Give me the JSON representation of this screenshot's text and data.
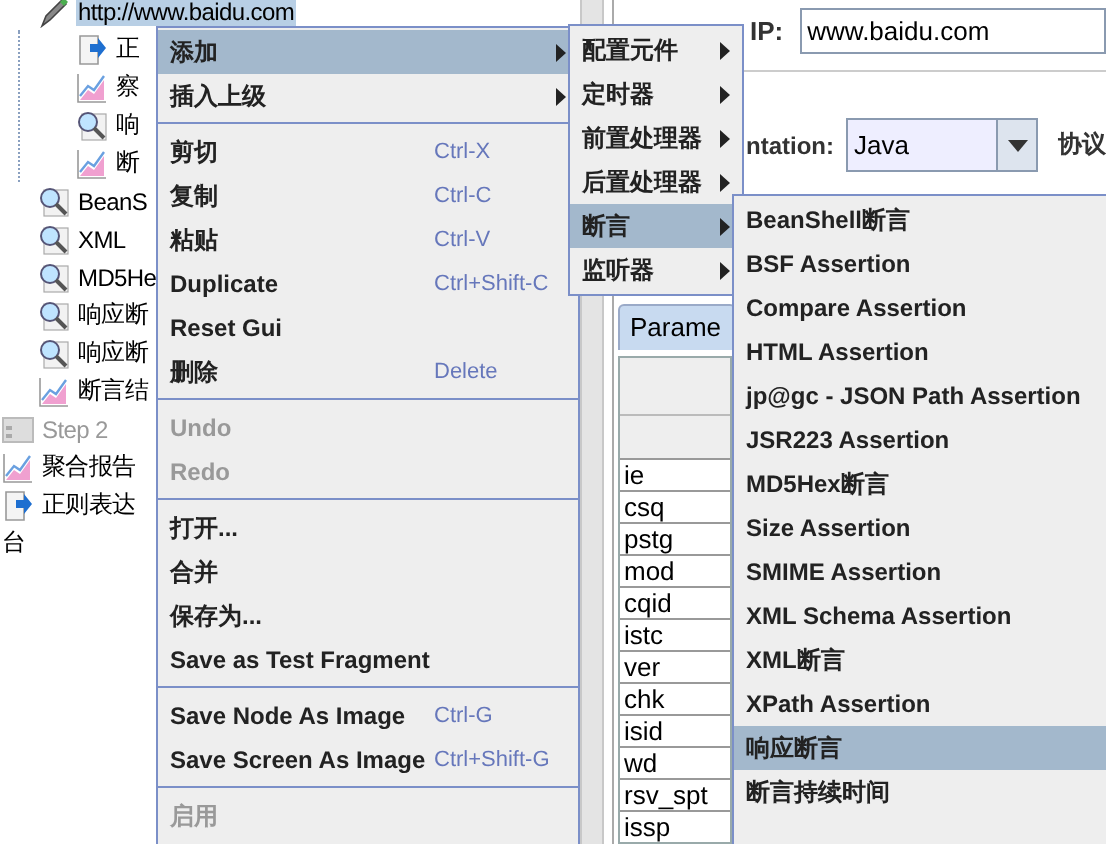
{
  "tree": {
    "items": [
      {
        "label": "http://www.baidu.com",
        "kind": "sampler",
        "selected": true,
        "disabled": false,
        "children": [
          {
            "label": "正",
            "kind": "extractor",
            "selected": false,
            "disabled": false
          },
          {
            "label": "察",
            "kind": "chart",
            "selected": false,
            "disabled": false
          },
          {
            "label": "响",
            "kind": "magnifier",
            "selected": false,
            "disabled": false
          },
          {
            "label": "断",
            "kind": "chart",
            "selected": false,
            "disabled": false
          }
        ]
      },
      {
        "label": "BeanS",
        "kind": "magnifier",
        "selected": false,
        "disabled": false
      },
      {
        "label": "XML",
        "kind": "magnifier",
        "selected": false,
        "disabled": false
      },
      {
        "label": "MD5He",
        "kind": "magnifier",
        "selected": false,
        "disabled": false
      },
      {
        "label": "响应断",
        "kind": "magnifier",
        "selected": false,
        "disabled": false
      },
      {
        "label": "响应断",
        "kind": "magnifier",
        "selected": false,
        "disabled": false
      },
      {
        "label": "断言结",
        "kind": "chart",
        "selected": false,
        "disabled": false
      }
    ],
    "outer_items": [
      {
        "label": "Step 2",
        "kind": "step",
        "selected": false,
        "disabled": true
      },
      {
        "label": "聚合报告",
        "kind": "chart",
        "selected": false,
        "disabled": false
      },
      {
        "label": "正则表达",
        "kind": "extractor",
        "selected": false,
        "disabled": false
      }
    ],
    "root_items": [
      {
        "label": "台",
        "selected": false,
        "disabled": false
      }
    ]
  },
  "panel": {
    "server_label": "IP:",
    "server_value": "www.baidu.com",
    "impl_label": "ntation:",
    "impl_value": "Java",
    "protocol_label": "协议",
    "tab": "Parame",
    "table_rows": [
      "ie",
      "csq",
      "pstg",
      "mod",
      "cqid",
      "istc",
      "ver",
      "chk",
      "isid",
      "wd",
      "rsv_spt",
      "issp"
    ]
  },
  "context_menu": {
    "items": [
      {
        "kind": "submenu",
        "label": "添加",
        "selected": true,
        "disabled": false
      },
      {
        "kind": "submenu",
        "label": "插入上级",
        "selected": false,
        "disabled": false
      },
      {
        "kind": "separator"
      },
      {
        "kind": "item",
        "label": "剪切",
        "shortcut": "Ctrl-X",
        "selected": false,
        "disabled": false
      },
      {
        "kind": "item",
        "label": "复制",
        "shortcut": "Ctrl-C",
        "selected": false,
        "disabled": false
      },
      {
        "kind": "item",
        "label": "粘贴",
        "shortcut": "Ctrl-V",
        "selected": false,
        "disabled": false
      },
      {
        "kind": "item",
        "label": "Duplicate",
        "shortcut": "Ctrl+Shift-C",
        "selected": false,
        "disabled": false
      },
      {
        "kind": "item",
        "label": "Reset Gui",
        "selected": false,
        "disabled": false
      },
      {
        "kind": "item",
        "label": "删除",
        "shortcut": "Delete",
        "selected": false,
        "disabled": false
      },
      {
        "kind": "separator"
      },
      {
        "kind": "item",
        "label": "Undo",
        "selected": false,
        "disabled": true
      },
      {
        "kind": "item",
        "label": "Redo",
        "selected": false,
        "disabled": true
      },
      {
        "kind": "separator"
      },
      {
        "kind": "item",
        "label": "打开...",
        "selected": false,
        "disabled": false
      },
      {
        "kind": "item",
        "label": "合并",
        "selected": false,
        "disabled": false
      },
      {
        "kind": "item",
        "label": "保存为...",
        "selected": false,
        "disabled": false
      },
      {
        "kind": "item",
        "label": "Save as Test Fragment",
        "selected": false,
        "disabled": false
      },
      {
        "kind": "separator"
      },
      {
        "kind": "item",
        "label": "Save Node As Image",
        "shortcut": "Ctrl-G",
        "selected": false,
        "disabled": false
      },
      {
        "kind": "item",
        "label": "Save Screen As Image",
        "shortcut": "Ctrl+Shift-G",
        "selected": false,
        "disabled": false
      },
      {
        "kind": "separator"
      },
      {
        "kind": "item",
        "label": "启用",
        "selected": false,
        "disabled": true
      }
    ]
  },
  "add_submenu": {
    "items": [
      {
        "kind": "submenu",
        "label": "配置元件",
        "selected": false,
        "disabled": false
      },
      {
        "kind": "submenu",
        "label": "定时器",
        "selected": false,
        "disabled": false
      },
      {
        "kind": "submenu",
        "label": "前置处理器",
        "selected": false,
        "disabled": false
      },
      {
        "kind": "submenu",
        "label": "后置处理器",
        "selected": false,
        "disabled": false
      },
      {
        "kind": "submenu",
        "label": "断言",
        "selected": true,
        "disabled": false
      },
      {
        "kind": "submenu",
        "label": "监听器",
        "selected": false,
        "disabled": false
      }
    ]
  },
  "assertion_submenu": {
    "items": [
      {
        "kind": "item",
        "label": "BeanShell断言",
        "selected": false,
        "disabled": false
      },
      {
        "kind": "item",
        "label": "BSF Assertion",
        "selected": false,
        "disabled": false
      },
      {
        "kind": "item",
        "label": "Compare Assertion",
        "selected": false,
        "disabled": false
      },
      {
        "kind": "item",
        "label": "HTML Assertion",
        "selected": false,
        "disabled": false
      },
      {
        "kind": "item",
        "label": "jp@gc - JSON Path Assertion",
        "selected": false,
        "disabled": false
      },
      {
        "kind": "item",
        "label": "JSR223 Assertion",
        "selected": false,
        "disabled": false
      },
      {
        "kind": "item",
        "label": "MD5Hex断言",
        "selected": false,
        "disabled": false
      },
      {
        "kind": "item",
        "label": "Size Assertion",
        "selected": false,
        "disabled": false
      },
      {
        "kind": "item",
        "label": "SMIME Assertion",
        "selected": false,
        "disabled": false
      },
      {
        "kind": "item",
        "label": "XML Schema Assertion",
        "selected": false,
        "disabled": false
      },
      {
        "kind": "item",
        "label": "XML断言",
        "selected": false,
        "disabled": false
      },
      {
        "kind": "item",
        "label": "XPath Assertion",
        "selected": false,
        "disabled": false
      },
      {
        "kind": "item",
        "label": "响应断言",
        "selected": true,
        "disabled": false
      },
      {
        "kind": "item",
        "label": "断言持续时间",
        "selected": false,
        "disabled": false
      }
    ]
  }
}
